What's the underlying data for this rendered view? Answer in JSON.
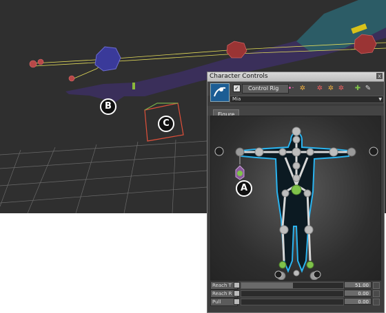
{
  "callouts": {
    "a": "A",
    "b": "B",
    "c": "C"
  },
  "panel": {
    "title": "Character Controls",
    "close_label": "x",
    "control_rig_checked": "✓",
    "control_rig_label": "Control Rig",
    "character_name": "Mia",
    "tab_figure": "Figure"
  },
  "reach": [
    {
      "label": "Reach T",
      "value": "51.00",
      "fraction": 0.51
    },
    {
      "label": "Reach R",
      "value": "0.00",
      "fraction": 0.0
    },
    {
      "label": "Pull",
      "value": "0.00",
      "fraction": 0.0
    }
  ],
  "icons": {
    "close": "close-icon",
    "check": "checkmark-icon",
    "character_logo": "character-logo-icon",
    "effector": "effector-toggle-icon",
    "figure": "figure-icon"
  },
  "colors": {
    "viewport_bg": "#2f2f2f",
    "panel_bg": "#3c3c3c",
    "joint_green": "#7fc24a",
    "effector_blue": "#2ab4f0",
    "rig_yellow": "#e8e05a",
    "marker_red": "#c04a4a",
    "marker_blue": "#3a3a9a"
  }
}
